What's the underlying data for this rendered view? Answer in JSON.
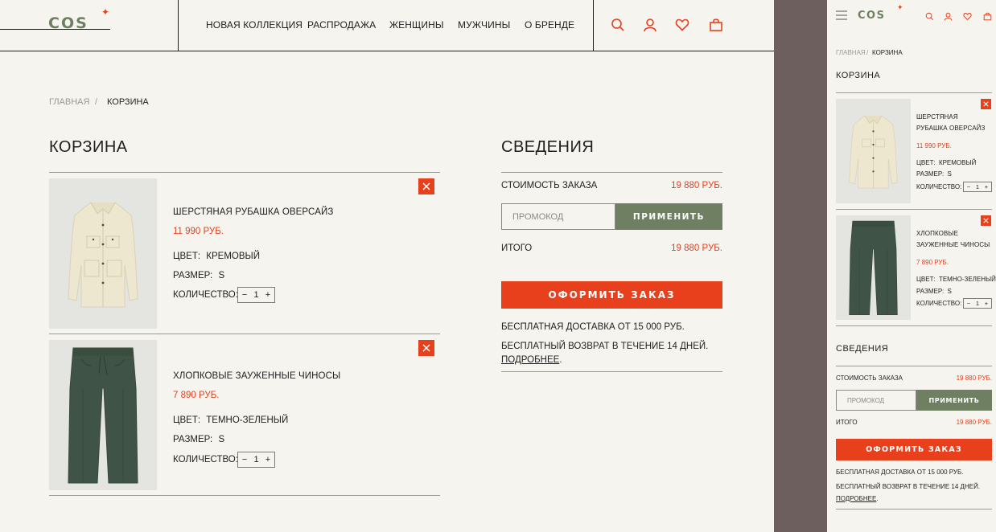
{
  "brand": {
    "logo": "COS",
    "accent": "#e8401c",
    "sage": "#6f7f62",
    "divider": "#6c5f5d",
    "bg": "#f5f4ef"
  },
  "nav": {
    "items": [
      "НОВАЯ КОЛЛЕКЦИЯ",
      "РАСПРОДАЖА",
      "ЖЕНЩИНЫ",
      "МУЖЧИНЫ",
      "О БРЕНДЕ"
    ]
  },
  "header_icons": [
    "search-icon",
    "user-icon",
    "heart-icon",
    "bag-icon",
    "menu-icon"
  ],
  "breadcrumb": {
    "home": "ГЛАВНАЯ",
    "sep": "/",
    "current": "КОРЗИНА"
  },
  "cart": {
    "title": "КОРЗИНА",
    "labels": {
      "color": "ЦВЕТ:",
      "size": "РАЗМЕР:",
      "qty": "КОЛИЧЕСТВО:",
      "minus": "−",
      "plus": "+"
    },
    "items": [
      {
        "name": "ШЕРСТЯНАЯ РУБАШКА ОВЕРСАЙЗ",
        "name_line1": "ШЕРСТЯНАЯ",
        "name_line2": "РУБАШКА ОВЕРСАЙЗ",
        "price": "11 990 РУБ.",
        "color": "КРЕМОВЫЙ",
        "size": "S",
        "qty": "1"
      },
      {
        "name": "ХЛОПКОВЫЕ ЗАУЖЕННЫЕ ЧИНОСЫ",
        "name_line1": "ХЛОПКОВЫЕ",
        "name_line2": "ЗАУЖЕННЫЕ ЧИНОСЫ",
        "price": "7 890 РУБ.",
        "color": "ТЕМНО-ЗЕЛЕНЫЙ",
        "size": "S",
        "qty": "1"
      }
    ]
  },
  "summary": {
    "title": "СВЕДЕНИЯ",
    "order_cost_label": "СТОИМОСТЬ ЗАКАЗА",
    "order_cost": "19 880 РУБ.",
    "promo_placeholder": "ПРОМОКОД",
    "apply": "ПРИМЕНИТЬ",
    "total_label": "ИТОГО",
    "total": "19 880 РУБ.",
    "checkout": "ОФОРМИТЬ ЗАКАЗ",
    "free_delivery": "БЕСПЛАТНАЯ ДОСТАВКА ОТ 15 000 РУБ.",
    "free_return": "БЕСПЛАТНЫЙ ВОЗВРАТ В ТЕЧЕНИЕ 14 ДНЕЙ.",
    "more": "ПОДРОБНЕЕ",
    "more_suffix": "."
  }
}
